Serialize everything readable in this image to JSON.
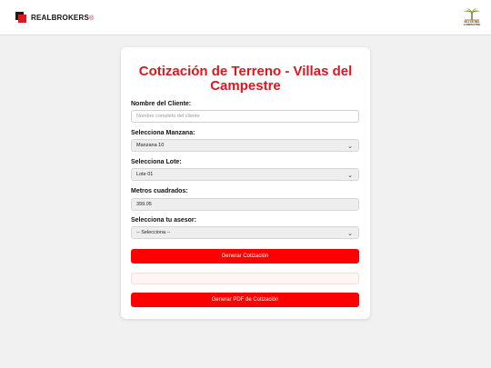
{
  "header": {
    "brand_main": "REALBROKERS",
    "brand_reg": "®",
    "partner_name": "VILLAS DEL CAMPESTRE"
  },
  "form": {
    "title": "Cotización de Terreno - Villas del Campestre",
    "client_label": "Nombre del Cliente:",
    "client_placeholder": "Nombre completo del cliente",
    "manzana_label": "Selecciona Manzana:",
    "manzana_value": "Manzana 10",
    "lote_label": "Selecciona Lote:",
    "lote_value": "Lote 01",
    "metros_label": "Metros cuadrados:",
    "metros_value": "399.05",
    "asesor_label": "Selecciona tu asesor:",
    "asesor_value": "-- Selecciona --",
    "generate_button": "Generar Cotización",
    "pdf_button": "Generar PDF de Cotización"
  },
  "colors": {
    "accent": "#e0161f",
    "button": "#ff0000"
  }
}
